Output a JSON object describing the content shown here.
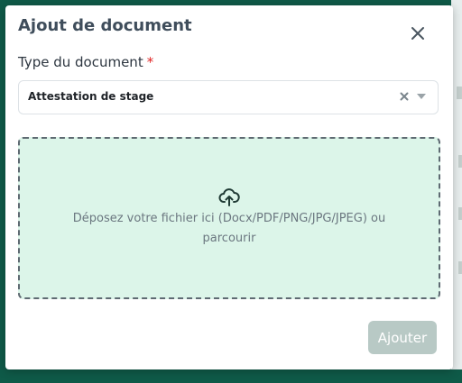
{
  "modal": {
    "title": "Ajout de document",
    "close_icon": "close-icon"
  },
  "form": {
    "type_label": "Type du document",
    "required_mark": "*",
    "type_value": "Attestation de stage",
    "clear_icon": "clear-icon",
    "dropdown_icon": "chevron-down-icon"
  },
  "dropzone": {
    "icon": "cloud-upload-icon",
    "text_line1": "Déposez votre fichier ici (Docx/PDF/PNG/JPG/JPEG) ou",
    "text_line2": "parcourir"
  },
  "actions": {
    "add_label": "Ajouter"
  },
  "colors": {
    "backdrop": "#0f5a48",
    "dropzone_bg": "#dcf5e9",
    "button_disabled": "#b8c9c5",
    "required": "#e02424"
  }
}
